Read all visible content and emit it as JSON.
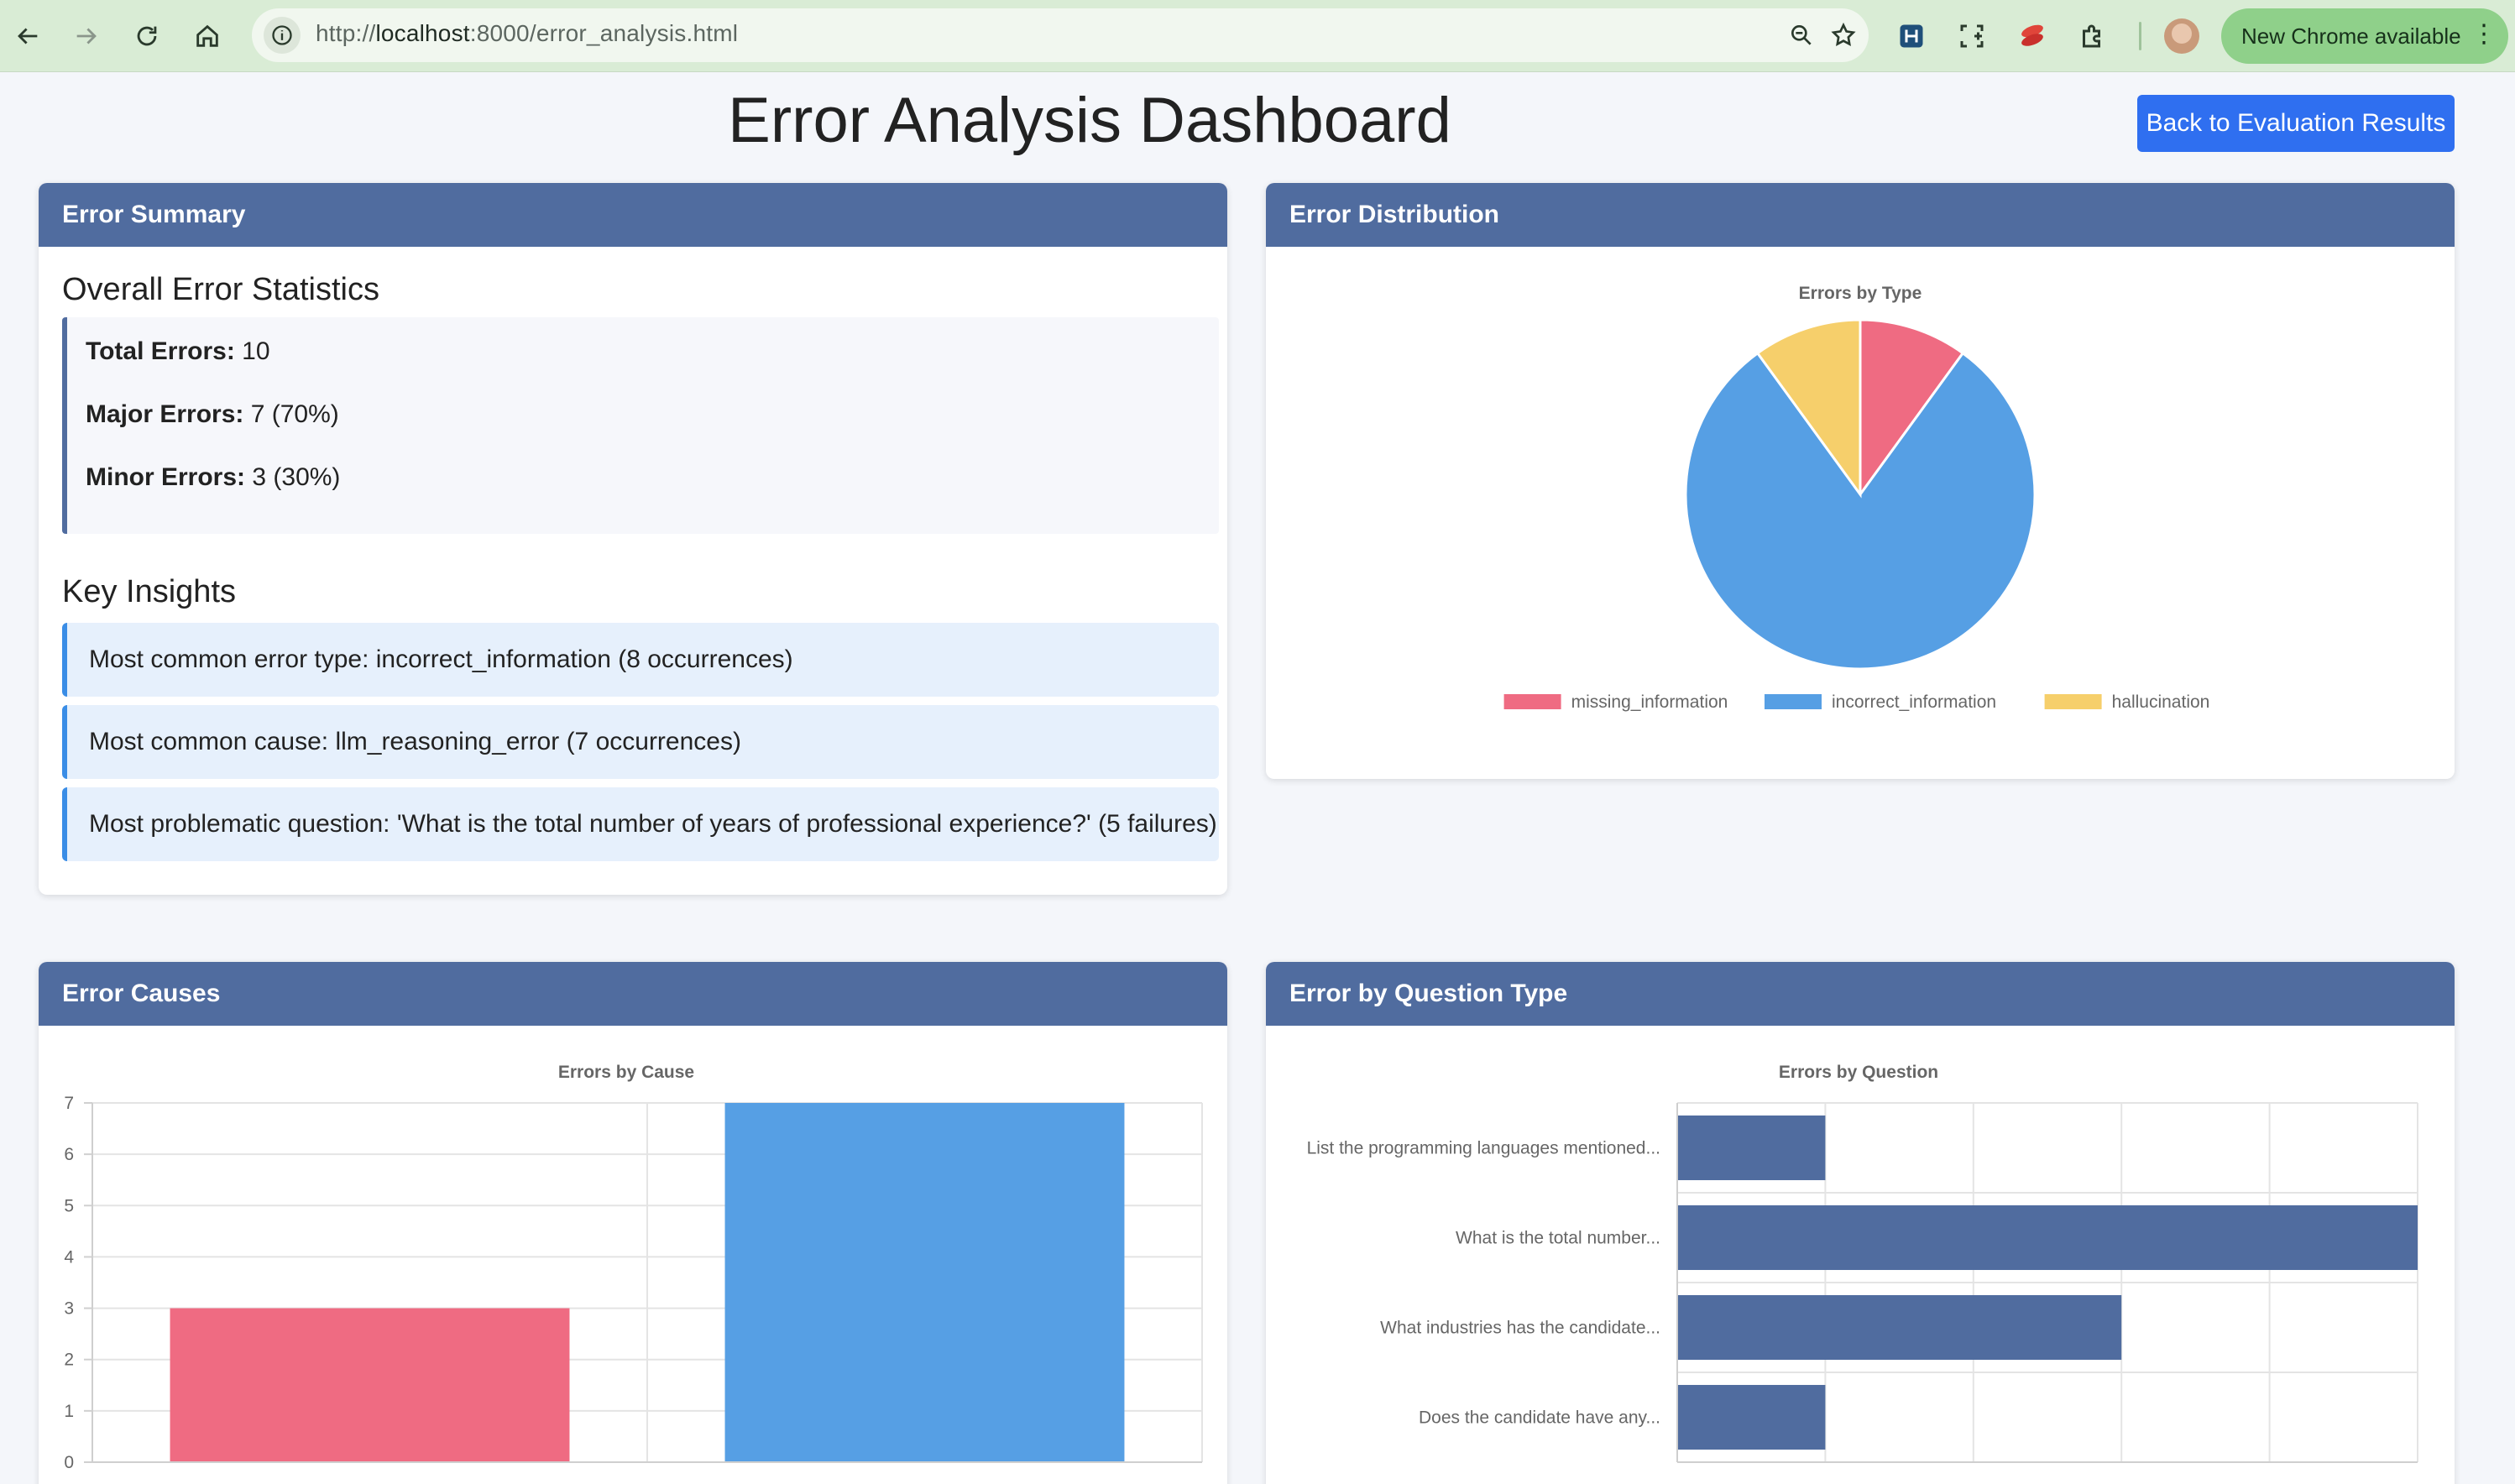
{
  "browser": {
    "url_prefix": "http://",
    "url_host": "localhost",
    "url_rest": ":8000/error_analysis.html",
    "update_label": "New Chrome available"
  },
  "page": {
    "title": "Error Analysis Dashboard",
    "back_button": "Back to Evaluation Results"
  },
  "summary": {
    "header": "Error Summary",
    "stats_heading": "Overall Error Statistics",
    "stats": [
      {
        "label": "Total Errors:",
        "value": "10"
      },
      {
        "label": "Major Errors:",
        "value": "7 (70%)"
      },
      {
        "label": "Minor Errors:",
        "value": "3 (30%)"
      }
    ],
    "insights_heading": "Key Insights",
    "insights": [
      "Most common error type: incorrect_information (8 occurrences)",
      "Most common cause: llm_reasoning_error (7 occurrences)",
      "Most problematic question: 'What is the total number of years of professional experience?' (5 failures)"
    ]
  },
  "distribution": {
    "header": "Error Distribution"
  },
  "causes": {
    "header": "Error Causes"
  },
  "questions": {
    "header": "Error by Question Type"
  },
  "chart_data": [
    {
      "type": "pie",
      "title": "Errors by Type",
      "labels": [
        "missing_information",
        "incorrect_information",
        "hallucination"
      ],
      "values": [
        1,
        8,
        1
      ],
      "colors": [
        "#ef6b82",
        "#569fe4",
        "#f6cf6b"
      ],
      "legend": "bottom"
    },
    {
      "type": "bar",
      "title": "Errors by Cause",
      "categories": [
        "",
        ""
      ],
      "values": [
        3,
        7
      ],
      "colors": [
        "#ef6b82",
        "#569fe4"
      ],
      "ylim": [
        0,
        7
      ],
      "yticks": [
        0,
        1,
        2,
        3,
        4,
        5,
        6,
        7
      ],
      "grid": true
    },
    {
      "type": "bar",
      "orientation": "horizontal",
      "title": "Errors by Question",
      "categories": [
        "List the programming languages mentioned...",
        "What is the total number...",
        "What industries has the candidate...",
        "Does the candidate have any..."
      ],
      "values": [
        1,
        5,
        3,
        1
      ],
      "color": "#506c9f",
      "xlim": [
        0,
        5
      ],
      "grid": true
    }
  ]
}
